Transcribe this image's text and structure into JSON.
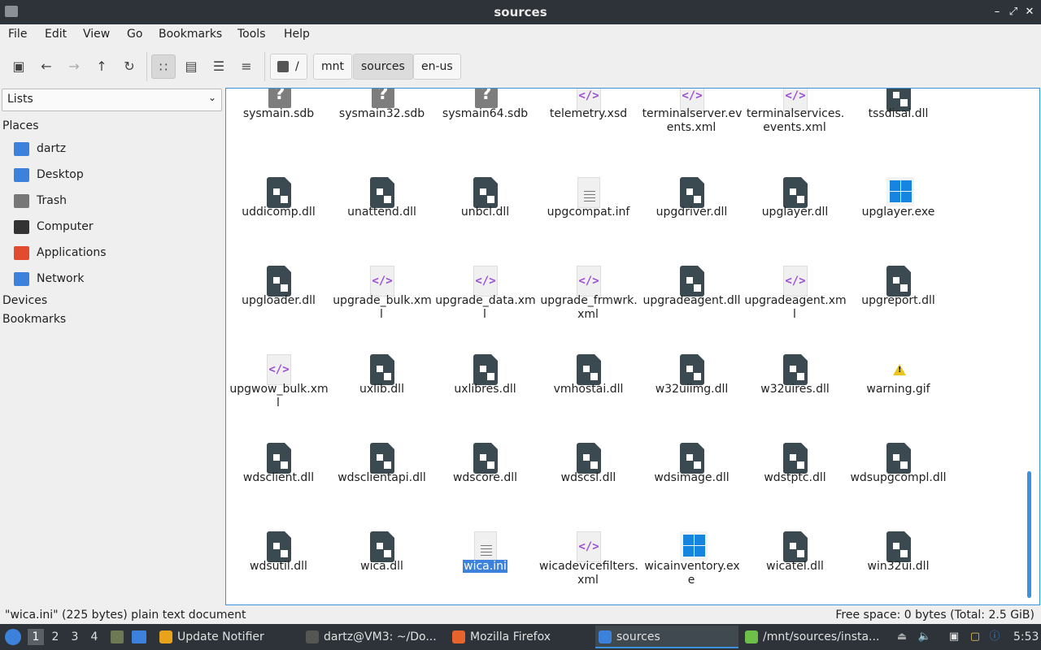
{
  "window": {
    "title": "sources"
  },
  "menu": [
    "File",
    "Edit",
    "View",
    "Go",
    "Bookmarks",
    "Tools",
    "Help"
  ],
  "breadcrumbs": [
    "/",
    "mnt",
    "sources",
    "en-us"
  ],
  "sidebar": {
    "mode": "Lists",
    "places_header": "Places",
    "places": [
      {
        "label": "dartz",
        "icon": "home-folder-icon",
        "color": "#3c82dc"
      },
      {
        "label": "Desktop",
        "icon": "desktop-icon",
        "color": "#3c82dc"
      },
      {
        "label": "Trash",
        "icon": "trash-icon",
        "color": "#777777"
      },
      {
        "label": "Computer",
        "icon": "computer-icon",
        "color": "#333333"
      },
      {
        "label": "Applications",
        "icon": "applications-icon",
        "color": "#e24b2f"
      },
      {
        "label": "Network",
        "icon": "network-folder-icon",
        "color": "#3c82dc"
      }
    ],
    "devices_header": "Devices",
    "bookmarks_header": "Bookmarks"
  },
  "files": [
    {
      "name": "sysmain.sdb",
      "type": "unknown"
    },
    {
      "name": "sysmain32.sdb",
      "type": "unknown"
    },
    {
      "name": "sysmain64.sdb",
      "type": "unknown"
    },
    {
      "name": "telemetry.xsd",
      "type": "xml"
    },
    {
      "name": "terminalserver.events.xml",
      "type": "xml"
    },
    {
      "name": "terminalservices.events.xml",
      "type": "xml"
    },
    {
      "name": "tssdisai.dll",
      "type": "dll"
    },
    {
      "name": "uddicomp.dll",
      "type": "dll"
    },
    {
      "name": "unattend.dll",
      "type": "dll"
    },
    {
      "name": "unbcl.dll",
      "type": "dll"
    },
    {
      "name": "upgcompat.inf",
      "type": "text"
    },
    {
      "name": "upgdriver.dll",
      "type": "dll"
    },
    {
      "name": "upglayer.dll",
      "type": "dll"
    },
    {
      "name": "upglayer.exe",
      "type": "exe"
    },
    {
      "name": "upgloader.dll",
      "type": "dll"
    },
    {
      "name": "upgrade_bulk.xml",
      "type": "xml"
    },
    {
      "name": "upgrade_data.xml",
      "type": "xml"
    },
    {
      "name": "upgrade_frmwrk.xml",
      "type": "xml"
    },
    {
      "name": "upgradeagent.dll",
      "type": "dll"
    },
    {
      "name": "upgradeagent.xml",
      "type": "xml"
    },
    {
      "name": "upgreport.dll",
      "type": "dll"
    },
    {
      "name": "upgwow_bulk.xml",
      "type": "xml"
    },
    {
      "name": "uxlib.dll",
      "type": "dll"
    },
    {
      "name": "uxlibres.dll",
      "type": "dll"
    },
    {
      "name": "vmhostai.dll",
      "type": "dll"
    },
    {
      "name": "w32uiimg.dll",
      "type": "dll"
    },
    {
      "name": "w32uires.dll",
      "type": "dll"
    },
    {
      "name": "warning.gif",
      "type": "image"
    },
    {
      "name": "wdsclient.dll",
      "type": "dll"
    },
    {
      "name": "wdsclientapi.dll",
      "type": "dll"
    },
    {
      "name": "wdscore.dll",
      "type": "dll"
    },
    {
      "name": "wdscsl.dll",
      "type": "dll"
    },
    {
      "name": "wdsimage.dll",
      "type": "dll"
    },
    {
      "name": "wdstptc.dll",
      "type": "dll"
    },
    {
      "name": "wdsupgcompl.dll",
      "type": "dll"
    },
    {
      "name": "wdsutil.dll",
      "type": "dll"
    },
    {
      "name": "wica.dll",
      "type": "dll"
    },
    {
      "name": "wica.ini",
      "type": "text",
      "selected": true
    },
    {
      "name": "wicadevicefilters.xml",
      "type": "xml"
    },
    {
      "name": "wicainventory.exe",
      "type": "exe"
    },
    {
      "name": "wicatel.dll",
      "type": "dll"
    },
    {
      "name": "win32ui.dll",
      "type": "dll"
    }
  ],
  "status": {
    "left": "\"wica.ini\" (225 bytes) plain text document",
    "right": "Free space: 0 bytes (Total: 2.5 GiB)"
  },
  "taskbar": {
    "workspaces": [
      "1",
      "2",
      "3",
      "4"
    ],
    "tasks": [
      {
        "label": "Update Notifier",
        "color": "#e8a21c"
      },
      {
        "label": "dartz@VM3: ~/Do...",
        "color": "#555555"
      },
      {
        "label": "Mozilla Firefox",
        "color": "#e8622c"
      },
      {
        "label": "sources",
        "color": "#3c82dc",
        "active": true
      },
      {
        "label": "/mnt/sources/insta...",
        "color": "#6cc04a"
      }
    ],
    "clock": "5:53"
  }
}
